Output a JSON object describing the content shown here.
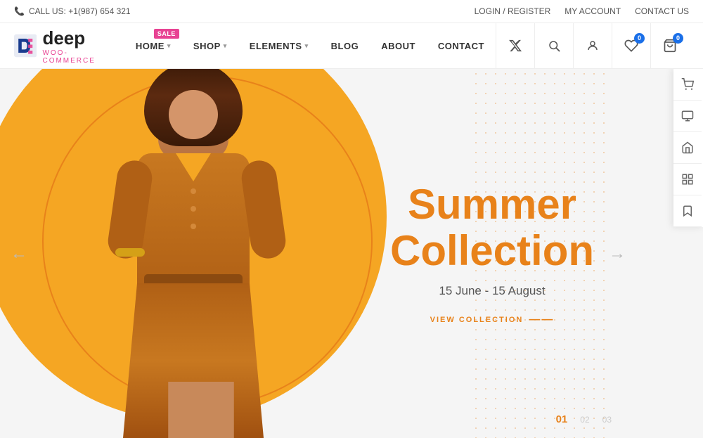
{
  "topbar": {
    "phone_icon": "📞",
    "call_label": "CALL US: +1(987) 654 321",
    "login_label": "LOGIN / REGISTER",
    "account_label": "MY ACCOUNT",
    "contact_label": "CONTACT US"
  },
  "logo": {
    "brand": "deep",
    "sub": "WOO-COMMERCE"
  },
  "nav": {
    "items": [
      {
        "label": "HOME",
        "has_dropdown": true,
        "sale_badge": "SALE"
      },
      {
        "label": "SHOP",
        "has_dropdown": true
      },
      {
        "label": "ELEMENTS",
        "has_dropdown": true
      },
      {
        "label": "BLOG",
        "has_dropdown": false
      },
      {
        "label": "ABOUT",
        "has_dropdown": false
      },
      {
        "label": "CONTACT",
        "has_dropdown": false
      }
    ]
  },
  "nav_icons": {
    "twitter": "𝕏",
    "search": "🔍",
    "user": "👤",
    "wishlist_count": "0",
    "cart_count": "0"
  },
  "hero": {
    "title_line1": "Summer",
    "title_line2": "Collection",
    "dates": "15 June - 15 August",
    "cta": "VIEW COLLECTION",
    "slide_indicators": [
      "01",
      "02",
      "03"
    ],
    "active_slide": 0
  },
  "sidebar_icons": [
    {
      "name": "cart-icon",
      "symbol": "🛒"
    },
    {
      "name": "monitor-icon",
      "symbol": "🖥"
    },
    {
      "name": "home-icon",
      "symbol": "🏠"
    },
    {
      "name": "grid-icon",
      "symbol": "⊞"
    },
    {
      "name": "bookmark-icon",
      "symbol": "🔖"
    }
  ]
}
